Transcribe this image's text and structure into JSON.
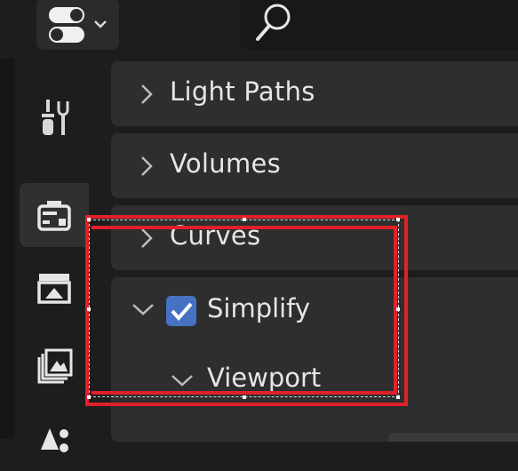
{
  "colors": {
    "accent": "#4672c4",
    "selection": "#e0212a",
    "panel": "#2e2e2e",
    "background": "#1d1d1d"
  },
  "header": {
    "editor_icon": "properties-editor-icon",
    "search_icon": "search-icon"
  },
  "tabs": [
    {
      "name": "tool-icon",
      "active": false
    },
    {
      "name": "render-icon",
      "active": true
    },
    {
      "name": "output-icon",
      "active": false
    },
    {
      "name": "view-layer-icon",
      "active": false
    },
    {
      "name": "scene-icon",
      "active": false
    }
  ],
  "panels": [
    {
      "label": "Light Paths",
      "expanded": false
    },
    {
      "label": "Volumes",
      "expanded": false
    },
    {
      "label": "Curves",
      "expanded": false
    }
  ],
  "simplify": {
    "label": "Simplify",
    "checked": true,
    "expanded": true
  },
  "viewport": {
    "label": "Viewport",
    "expanded": true
  }
}
